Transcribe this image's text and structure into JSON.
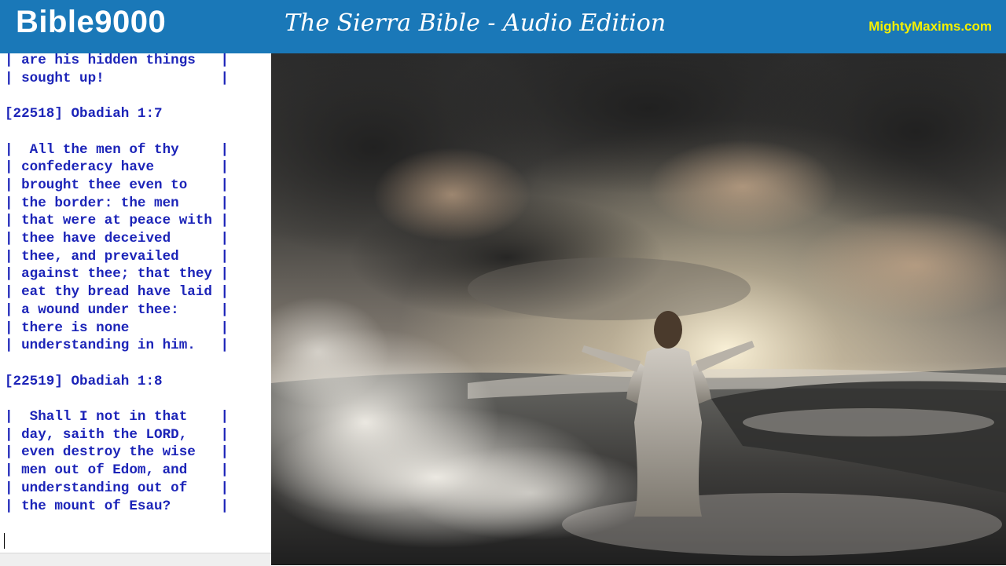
{
  "header": {
    "brand": "Bible9000",
    "title": "The Sierra Bible - Audio Edition",
    "site": "MightyMaxims.com"
  },
  "colors": {
    "header_bg": "#1a78b8",
    "site_link": "#f4f000",
    "verse_text": "#1c24b8"
  },
  "text_lines": [
    "| are his hidden things   |",
    "| sought up!              |",
    "",
    "[22518] Obadiah 1:7",
    "",
    "|  All the men of thy     |",
    "| confederacy have        |",
    "| brought thee even to    |",
    "| the border: the men     |",
    "| that were at peace with |",
    "| thee have deceived      |",
    "| thee, and prevailed     |",
    "| against thee; that they |",
    "| eat thy bread have laid |",
    "| a wound under thee:     |",
    "| there is none           |",
    "| understanding in him.   |",
    "",
    "[22519] Obadiah 1:8",
    "",
    "|  Shall I not in that    |",
    "| day, saith the LORD,    |",
    "| even destroy the wise   |",
    "| men out of Edom, and    |",
    "| understanding out of    |",
    "| the mount of Esau?      |"
  ]
}
